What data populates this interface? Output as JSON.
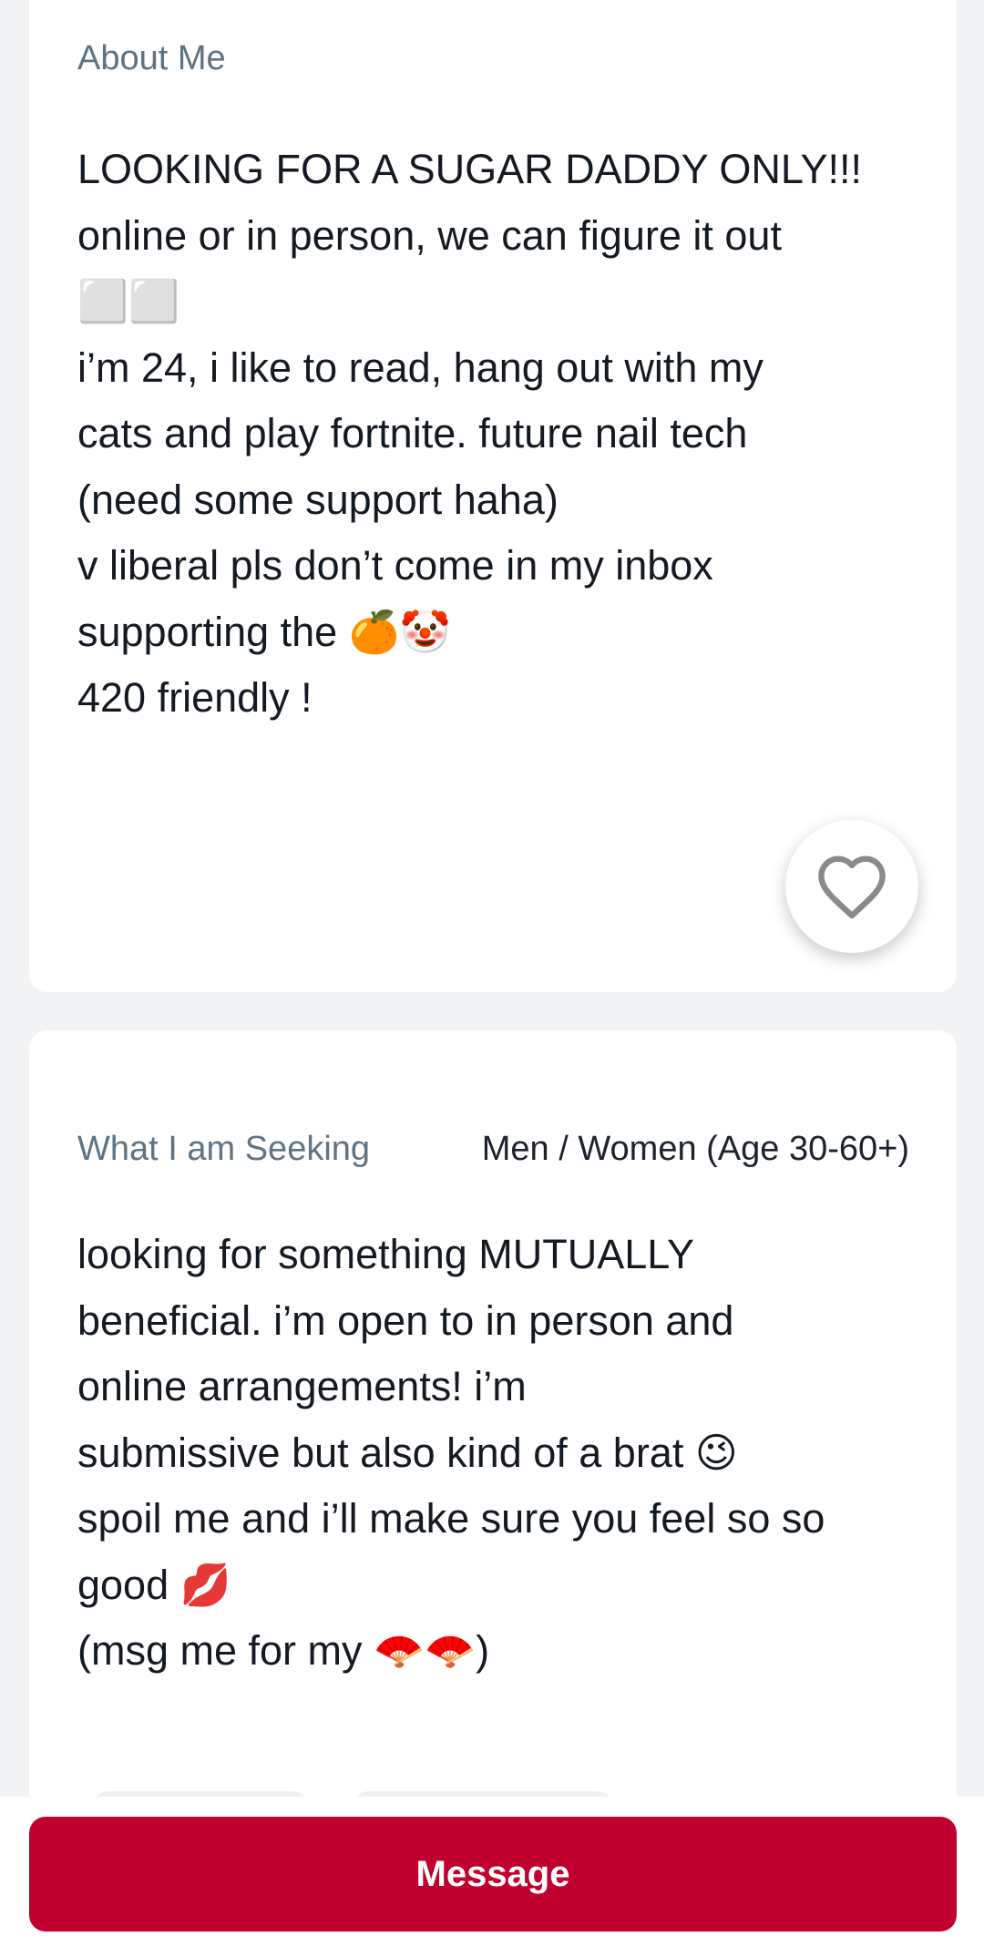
{
  "about": {
    "label": "About Me",
    "text": "LOOKING FOR A SUGAR DADDY ONLY!!!\nonline or in person, we can figure it out\n⬜⬜\ni’m 24, i like to read, hang out with my\ncats and play fortnite. future nail tech\n(need some support haha)\nv liberal pls don’t come in my inbox\nsupporting the 🍊🤡\n420 friendly !"
  },
  "like_button": {
    "icon": "heart-outline-icon",
    "color": "#8a8a8a"
  },
  "seeking": {
    "label": "What I am Seeking",
    "value": "Men / Women  (Age 30-60+)",
    "text": "looking for something MUTUALLY\nbeneficial. i’m open to in person and\nonline arrangements! i’m\nsubmissive but also kind of a brat 😉\nspoil me and i’ll make sure you feel so so\ngood 💋\n(msg me for my 🪭🪭)"
  },
  "bottom_bar": {
    "message_label": "Message",
    "accent_color": "#c0002e"
  }
}
